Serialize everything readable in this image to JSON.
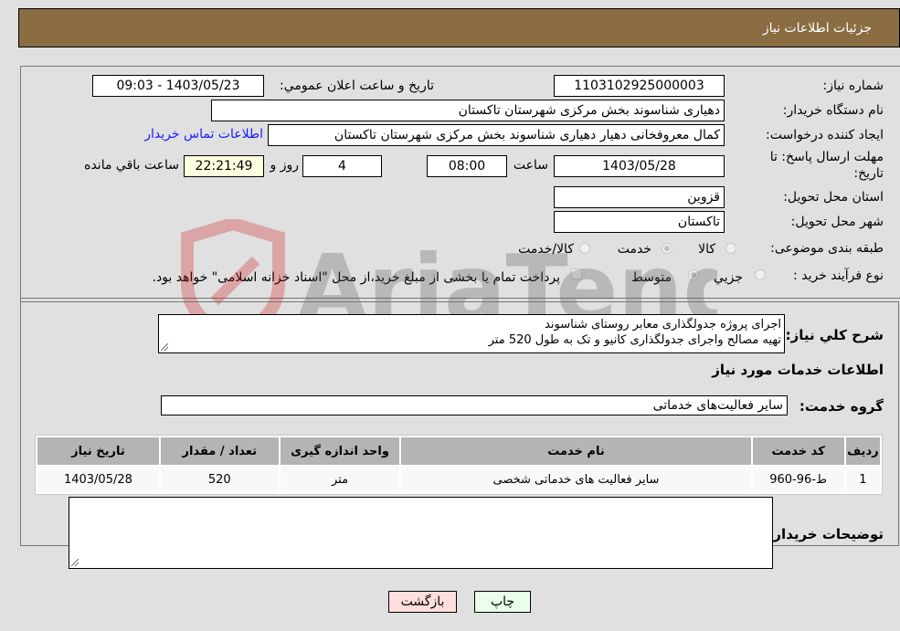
{
  "header": {
    "title": "جزئیات اطلاعات نیاز"
  },
  "form": {
    "need_number": {
      "label": "شماره نیاز:",
      "value": "1103102925000003"
    },
    "announce_datetime": {
      "label": "تاریخ و ساعت اعلان عمومي:",
      "value": "1403/05/23 - 09:03"
    },
    "buyer_org": {
      "label": "نام دستگاه خریدار:",
      "value": "دهیاری شناسوند بخش مرکزی شهرستان تاکستان"
    },
    "requester": {
      "label": "ایجاد کننده درخواست:",
      "value": "کمال معروفخانی دهیار دهیاری شناسوند بخش مرکزی شهرستان تاکستان"
    },
    "contact_link": "اطلاعات تماس خریدار",
    "deadline": {
      "label_line1": "مهلت ارسال پاسخ: تا",
      "label_line2": "تاریخ:",
      "date": "1403/05/28",
      "time_label": "ساعت",
      "time": "08:00",
      "days": "4",
      "days_label": "روز و",
      "remaining": "22:21:49",
      "remaining_label": "ساعت باقي مانده"
    },
    "province": {
      "label": "استان محل تحویل:",
      "value": "قزوین"
    },
    "city": {
      "label": "شهر محل تحویل:",
      "value": "تاکستان"
    },
    "category": {
      "label": "طبقه بندی موضوعی:",
      "options": [
        "کالا",
        "خدمت",
        "کالا/خدمت"
      ],
      "selected": "خدمت"
    },
    "purchase_type": {
      "label": "نوع فرآیند خرید :",
      "options": [
        "جزيي",
        "متوسط"
      ],
      "selected": "متوسط",
      "treasury_note": "پرداخت تمام یا بخشی از مبلغ خرید،از محل \"اسناد خزانه اسلامی\" خواهد بود."
    }
  },
  "description": {
    "label": "شرح کلي نياز:",
    "line1": "اجرای پروژه جدولگذاری معابر روستای شناسوند",
    "line2": "تهیه مصالح واجرای جدولگذاری کانیو و تک به طول 520 متر"
  },
  "services_section": {
    "title": "اطلاعات خدمات مورد نياز",
    "group_label": "گروه خدمت:",
    "group_value": "سایر فعالیت‌های خدماتی"
  },
  "table": {
    "headers": [
      "رديف",
      "کد خدمت",
      "نام خدمت",
      "واحد اندازه گیری",
      "تعداد / مقدار",
      "تاریخ نیاز"
    ],
    "rows": [
      [
        "1",
        "ط-96-960",
        "سایر فعالیت های خدماتی شخصی",
        "متر",
        "520",
        "1403/05/28"
      ]
    ]
  },
  "buyer_notes": {
    "label": "توضیحات خریدار:",
    "value": ""
  },
  "buttons": {
    "print": "چاپ",
    "back": "بازگشت"
  },
  "watermark": "AriaTender.neT"
}
